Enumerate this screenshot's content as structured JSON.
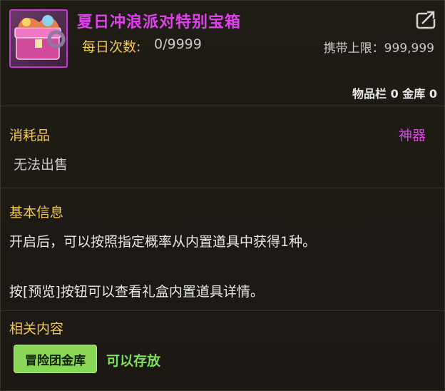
{
  "item": {
    "title": "夏日冲浪派对特别宝箱",
    "daily_label": "每日次数:",
    "daily_value": "0/9999",
    "carry_limit": "携带上限：999,999",
    "storage": "物品栏 0 金库 0"
  },
  "details": {
    "type": "消耗品",
    "rarity": "神器",
    "sell_status": "无法出售",
    "basic_info_title": "基本信息",
    "description_1": "开启后，可以按照指定概率从内置道具中获得1种。",
    "description_2": "按[预览]按钮可以查看礼盒内置道具详情。"
  },
  "related": {
    "title": "相关内容",
    "tag_label": "冒险团金库",
    "tag_status": "可以存放"
  },
  "colors": {
    "title": "#e23ff0",
    "section": "#f2c94c",
    "green_tag": "#8cd657",
    "green_text": "#7ee058"
  },
  "icons": {
    "item": "treasure-chest-icon",
    "share": "share-export-icon"
  }
}
